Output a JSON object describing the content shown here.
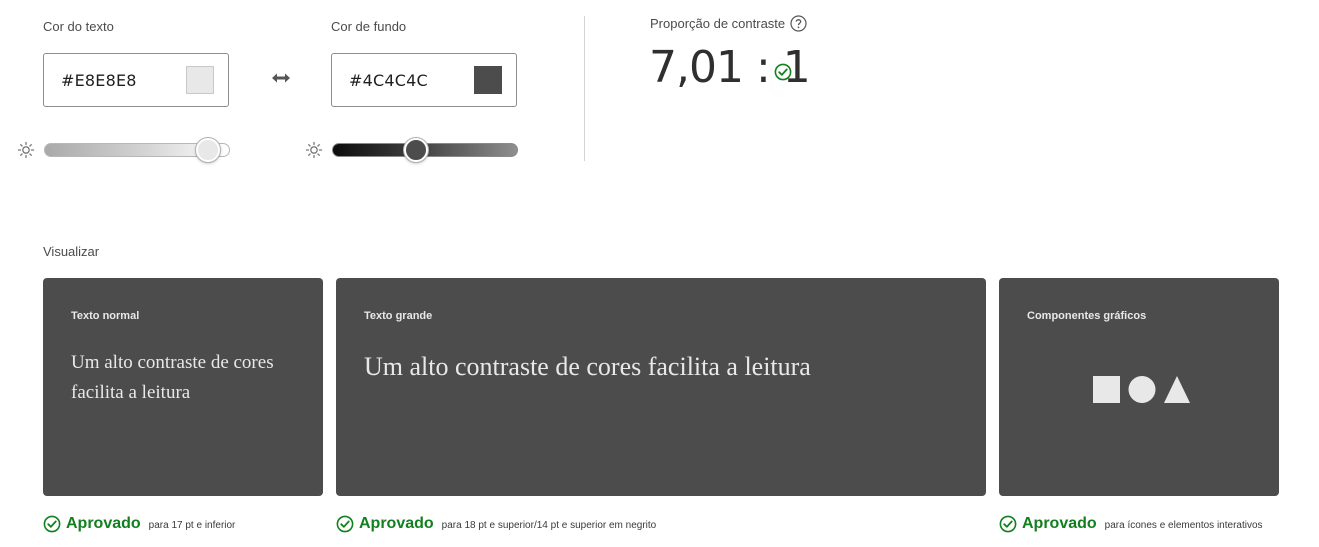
{
  "text_color": {
    "label": "Cor do texto",
    "value": "#E8E8E8",
    "swatch": "#e8e8e8",
    "brightness_level": 0.88
  },
  "swap_icon": "swap-arrows-icon",
  "background_color": {
    "label": "Cor de fundo",
    "value": "#4C4C4C",
    "swatch": "#4c4c4c",
    "brightness_level": 0.45
  },
  "contrast": {
    "label": "Proporção de contraste",
    "help_icon": "help-icon",
    "ratio": "7,01 : 1",
    "status_icon": "check-circle-icon"
  },
  "preview": {
    "label": "Visualizar",
    "cards": [
      {
        "title": "Texto normal",
        "sample": "Um alto contraste de cores facilita a leitura",
        "result": "Aprovado",
        "note": "para 17 pt e inferior"
      },
      {
        "title": "Texto grande",
        "sample": "Um alto contraste de cores facilita a leitura",
        "result": "Aprovado",
        "note": "para 18 pt e superior/14 pt e superior em negrito"
      },
      {
        "title": "Componentes gráficos",
        "shapes": [
          "square-icon",
          "circle-icon",
          "triangle-icon"
        ],
        "result": "Aprovado",
        "note": "para ícones e elementos interativos"
      }
    ]
  },
  "colors": {
    "pass_green": "#12801f",
    "card_bg": "#4c4c4c",
    "card_text": "#e8e8e8"
  }
}
